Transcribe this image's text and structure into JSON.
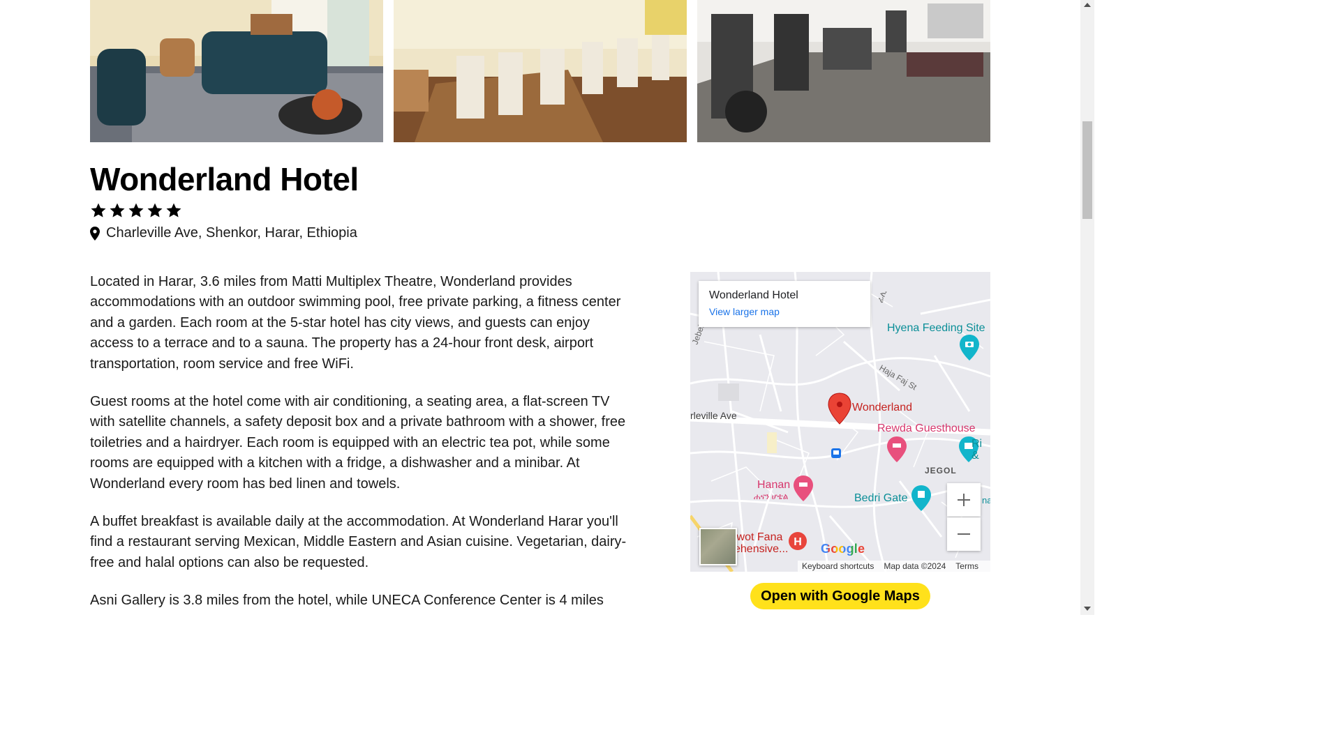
{
  "hotel": {
    "name": "Wonderland Hotel",
    "star_rating": 5,
    "address": "Charleville Ave, Shenkor, Harar, Ethiopia"
  },
  "gallery": [
    {
      "icon": "lounge-photo"
    },
    {
      "icon": "restaurant-photo"
    },
    {
      "icon": "gym-photo"
    }
  ],
  "description": [
    "Located in Harar, 3.6 miles from Matti Multiplex Theatre, Wonderland provides accommodations with an outdoor swimming pool, free private parking, a fitness center and a garden. Each room at the 5-star hotel has city views, and guests can enjoy access to a terrace and to a sauna. The property has a 24-hour front desk, airport transportation, room service and free WiFi.",
    "Guest rooms at the hotel come with air conditioning, a seating area, a flat-screen TV with satellite channels, a safety deposit box and a private bathroom with a shower, free toiletries and a hairdryer. Each room is equipped with an electric tea pot, while some rooms are equipped with a kitchen with a fridge, a dishwasher and a minibar. At Wonderland every room has bed linen and towels.",
    "A buffet breakfast is available daily at the accommodation. At Wonderland Harar you'll find a restaurant serving Mexican, Middle Eastern and Asian cuisine. Vegetarian, dairy-free and halal options can also be requested.",
    "Asni Gallery is 3.8 miles from the hotel, while UNECA Conference Center is 4 miles"
  ],
  "map": {
    "card_title": "Wonderland Hotel",
    "card_link": "View larger map",
    "labels": {
      "hyena": "Hyena Feeding Site",
      "wonderland": "Wonderland",
      "rewda": "Rewda Guesthouse",
      "jegol": "JEGOL",
      "hanan": "Hanan",
      "hanan_amharic": "ሐናን ሆቴል",
      "bedri": "Bedri Gate",
      "fana": "iwot Fana",
      "fana2": "ehensive...",
      "street": "rleville Ave",
      "ri": "Ri",
      "ri2": "&",
      "na": "na"
    },
    "google_logo": "Google",
    "footer": {
      "shortcuts": "Keyboard shortcuts",
      "data": "Map data ©2024",
      "terms": "Terms"
    },
    "colors": {
      "pin": "#ea4335",
      "hotel_poi": "#e8507d",
      "attraction_poi": "#12b5cb"
    }
  },
  "button": {
    "open_maps": "Open with Google Maps"
  },
  "accent_colors": {
    "button_yellow": "#ffe11b",
    "link_blue": "#1a73e8"
  }
}
